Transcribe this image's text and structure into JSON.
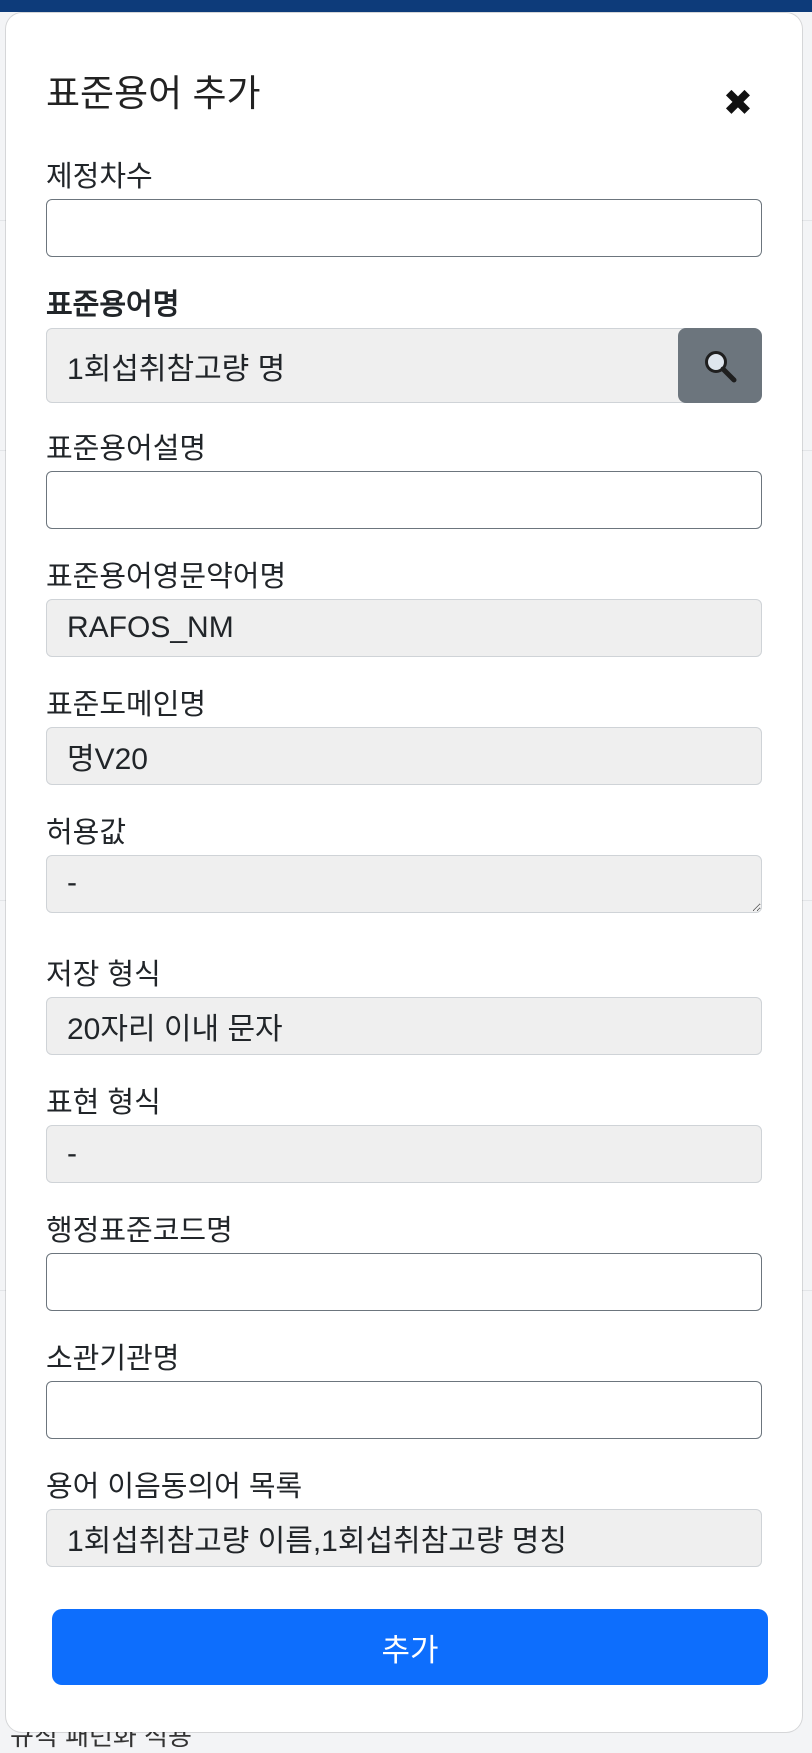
{
  "background": {
    "peek_text": "규칙 패턴화 적용"
  },
  "modal": {
    "title": "표준용어 추가",
    "close_icon": "close-icon",
    "submit_label": "추가"
  },
  "fields": {
    "enactment_order": {
      "label": "제정차수",
      "value": ""
    },
    "term_name": {
      "label": "표준용어명",
      "value": "1회섭취참고량 명",
      "search_icon": "search-icon"
    },
    "term_description": {
      "label": "표준용어설명",
      "value": ""
    },
    "term_abbreviation": {
      "label": "표준용어영문약어명",
      "value": "RAFOS_NM"
    },
    "domain_name": {
      "label": "표준도메인명",
      "value": "명V20"
    },
    "allowed_values": {
      "label": "허용값",
      "value": "-"
    },
    "storage_format": {
      "label": "저장 형식",
      "value": "20자리 이내 문자"
    },
    "display_format": {
      "label": "표현 형식",
      "value": "-"
    },
    "admin_code_name": {
      "label": "행정표준코드명",
      "value": ""
    },
    "agency_name": {
      "label": "소관기관명",
      "value": ""
    },
    "synonyms": {
      "label": "용어 이음동의어 목록",
      "value": "1회섭취참고량 이름,1회섭취참고량 명칭"
    }
  },
  "colors": {
    "primary": "#0d6efd",
    "secondary": "#6c757d",
    "readonly_bg": "#efefef"
  }
}
